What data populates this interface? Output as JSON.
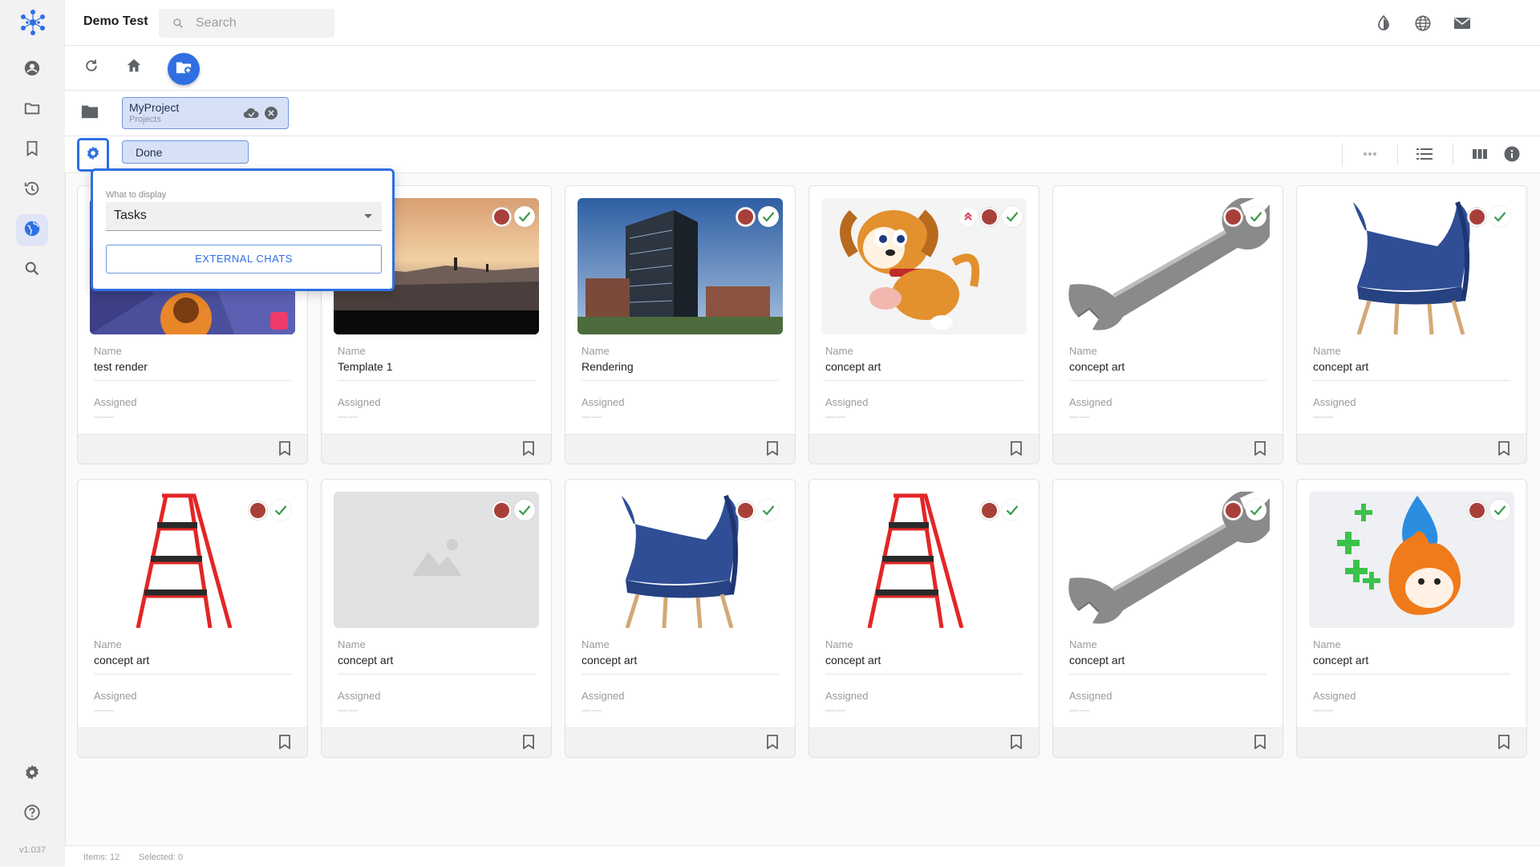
{
  "app": {
    "title": "Demo Test",
    "version": "v1.037"
  },
  "search": {
    "placeholder": "Search"
  },
  "breadcrumb": {
    "name": "MyProject",
    "sub": "Projects"
  },
  "filter": {
    "chip": "Done"
  },
  "popover": {
    "label": "What to display",
    "selected": "Tasks",
    "button": "EXTERNAL CHATS"
  },
  "card_labels": {
    "name": "Name",
    "assigned": "Assigned",
    "assigned_empty": "——"
  },
  "cards": [
    {
      "name": "test render",
      "thumb": "render",
      "has_check": false,
      "priority": false
    },
    {
      "name": "Template 1",
      "thumb": "city",
      "has_check": true,
      "priority": false
    },
    {
      "name": "Rendering",
      "thumb": "building",
      "has_check": true,
      "priority": false
    },
    {
      "name": "concept art",
      "thumb": "dog",
      "has_check": true,
      "priority": true
    },
    {
      "name": "concept art",
      "thumb": "wrench",
      "has_check": true,
      "priority": false
    },
    {
      "name": "concept art",
      "thumb": "chair",
      "has_check": true,
      "priority": false
    },
    {
      "name": "concept art",
      "thumb": "ladder",
      "has_check": true,
      "priority": false
    },
    {
      "name": "concept art",
      "thumb": "placeholder",
      "has_check": true,
      "priority": false
    },
    {
      "name": "concept art",
      "thumb": "chair",
      "has_check": true,
      "priority": false
    },
    {
      "name": "concept art",
      "thumb": "ladder",
      "has_check": true,
      "priority": false
    },
    {
      "name": "concept art",
      "thumb": "wrench",
      "has_check": true,
      "priority": false
    },
    {
      "name": "concept art",
      "thumb": "fire",
      "has_check": true,
      "priority": false
    }
  ],
  "status": {
    "items": "Items: 12",
    "selected": "Selected: 0"
  },
  "colors": {
    "accent": "#2f6fe2",
    "status_red": "#a8403a",
    "check_green": "#3a9a4c"
  }
}
